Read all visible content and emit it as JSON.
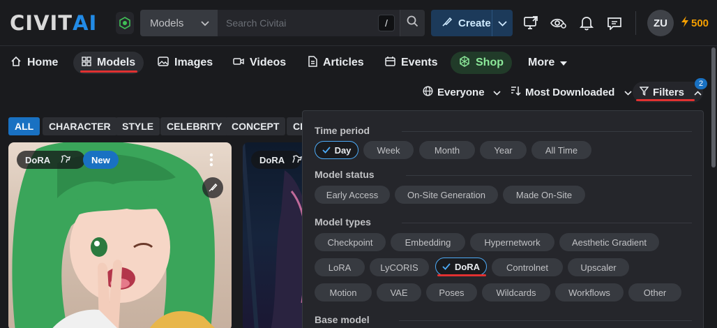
{
  "header": {
    "logo_main": "CIVIT",
    "logo_accent": "AI",
    "search_category": "Models",
    "search_placeholder": "Search Civitai",
    "slash_key": "/",
    "create_label": "Create",
    "avatar_initials": "ZU",
    "buzz_amount": "500"
  },
  "nav": {
    "items": [
      {
        "label": "Home",
        "icon": "home-icon"
      },
      {
        "label": "Models",
        "icon": "grid-icon"
      },
      {
        "label": "Images",
        "icon": "image-icon"
      },
      {
        "label": "Videos",
        "icon": "video-icon"
      },
      {
        "label": "Articles",
        "icon": "document-icon"
      },
      {
        "label": "Events",
        "icon": "calendar-icon"
      },
      {
        "label": "Shop",
        "icon": "shop-icon"
      },
      {
        "label": "More",
        "icon": "caret-down-icon"
      }
    ]
  },
  "sort": {
    "audience": "Everyone",
    "sort_by": "Most Downloaded",
    "filters_label": "Filters",
    "filters_count": "2"
  },
  "tags": [
    "ALL",
    "CHARACTER",
    "STYLE",
    "CELEBRITY",
    "CONCEPT",
    "CL"
  ],
  "cards": [
    {
      "type": "DoRA",
      "new_label": "New"
    },
    {
      "type": "DoRA"
    }
  ],
  "filters": {
    "time_period": {
      "title": "Time period",
      "options": [
        "Day",
        "Week",
        "Month",
        "Year",
        "All Time"
      ],
      "selected": "Day"
    },
    "model_status": {
      "title": "Model status",
      "options": [
        "Early Access",
        "On-Site Generation",
        "Made On-Site"
      ]
    },
    "model_types": {
      "title": "Model types",
      "options": [
        "Checkpoint",
        "Embedding",
        "Hypernetwork",
        "Aesthetic Gradient",
        "LoRA",
        "LyCORIS",
        "DoRA",
        "Controlnet",
        "Upscaler",
        "Motion",
        "VAE",
        "Poses",
        "Wildcards",
        "Workflows",
        "Other"
      ],
      "selected": "DoRA"
    },
    "base_model": {
      "title": "Base model"
    }
  },
  "colors": {
    "accent": "#228be6",
    "highlight_red": "#e03131",
    "buzz": "#f59f00",
    "shop_green": "#8ce99a"
  }
}
